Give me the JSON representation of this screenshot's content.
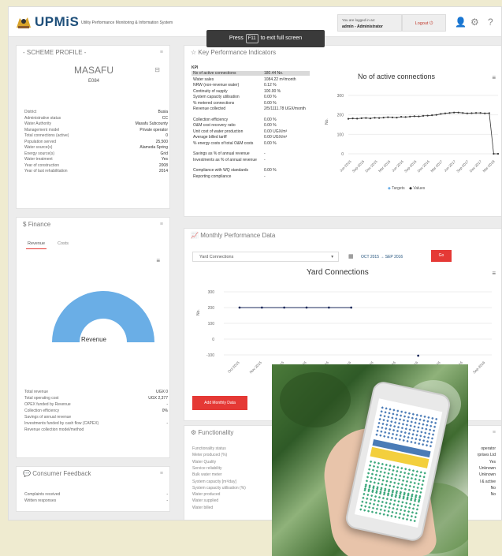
{
  "header": {
    "app_name": "UPMiS",
    "app_subtitle": "Utility Performance Monitoring & Information System",
    "logged_in_label": "You are logged in as:",
    "user": "admin - Administrator",
    "logout_label": "Logout",
    "fullscreen_press": "Press",
    "fullscreen_key": "F11",
    "fullscreen_text": "to exit full screen"
  },
  "scheme_profile": {
    "title": "- SCHEME PROFILE -",
    "name": "MASAFU",
    "code": "E084",
    "rows": [
      {
        "k": "District",
        "v": "Busia"
      },
      {
        "k": "Administrative status",
        "v": "CC"
      },
      {
        "k": "Water Authority",
        "v": "Masafu Subcounty"
      },
      {
        "k": "Management model",
        "v": "Private operator"
      },
      {
        "k": "Total connections (active)",
        "v": "0"
      },
      {
        "k": "Population served",
        "v": "25,500"
      },
      {
        "k": "Water source(s)",
        "v": "Alameda Spring"
      },
      {
        "k": "Energy source(s)",
        "v": "Grid"
      },
      {
        "k": "Water treatment",
        "v": "Yes"
      },
      {
        "k": "Year of construction",
        "v": "2008"
      },
      {
        "k": "Year of last rehabilitation",
        "v": "2014"
      }
    ]
  },
  "kpi": {
    "title": "Key Performance Indicators",
    "header": "KPI",
    "rows": [
      {
        "k": "No of active connections",
        "v": "180.44 No."
      },
      {
        "k": "Water sales",
        "v": "1084.22 m³/month"
      },
      {
        "k": "NRW (non-revenue water)",
        "v": "0.12 %"
      },
      {
        "k": "Continuity of supply",
        "v": "100.00 %"
      },
      {
        "k": "System capacity utilisation",
        "v": "0.00 %"
      },
      {
        "k": "% metered connections",
        "v": "0.00 %"
      },
      {
        "k": "Revenue collected",
        "v": "2/5/1111.78 UGX/month"
      },
      {
        "k": "Collection efficiency",
        "v": "0.00 %"
      },
      {
        "k": "O&M cost recovery ratio",
        "v": "0.00 %"
      },
      {
        "k": "Unit cost of water production",
        "v": "0.00 UGX/m³"
      },
      {
        "k": "Average billed tariff",
        "v": "0.00 UGX/m³"
      },
      {
        "k": "% energy costs of total O&M costs",
        "v": "0.00 %"
      },
      {
        "k": "Savings as % of annual revenue",
        "v": "-"
      },
      {
        "k": "Investments as % of annual revenue",
        "v": "-"
      },
      {
        "k": "Compliance with WQ standards",
        "v": "0.00 %"
      },
      {
        "k": "Reporting compliance",
        "v": "-"
      }
    ]
  },
  "conn_chart": {
    "title": "No of active connections",
    "ylabel": "No.",
    "yticks": [
      "300",
      "200",
      "100",
      "0"
    ],
    "xticks": [
      "Jun-2015",
      "Sep-2015",
      "Dec-2015",
      "Mar-2016",
      "Jun-2016",
      "Sep-2016",
      "Dec-2016",
      "Mar-2017",
      "Jun-2017",
      "Sep-2017",
      "Dec-2017",
      "Mar-2018"
    ],
    "legend_targets": "Targets",
    "legend_values": "Values"
  },
  "chart_data": [
    {
      "type": "line",
      "title": "No of active connections",
      "ylabel": "No.",
      "ylim": [
        0,
        300
      ],
      "series": [
        {
          "name": "Values",
          "values": [
            180,
            182,
            181,
            183,
            184,
            182,
            185,
            184,
            186,
            188,
            187,
            186,
            190,
            189,
            191,
            193,
            192,
            195,
            196,
            198,
            200,
            205,
            208,
            210,
            212,
            212,
            210,
            208,
            209,
            210,
            210,
            208,
            209,
            0,
            0
          ]
        }
      ]
    },
    {
      "type": "line",
      "title": "Yard Connections",
      "ylabel": "No.",
      "ylim": [
        0,
        300
      ],
      "categories": [
        "Oct-2015",
        "Nov-2015",
        "Dec-2015",
        "Jan-2016",
        "Feb-2016",
        "Mar-2016",
        "Apr-2016",
        "May-2016",
        "Jun-2016",
        "Jul-2016",
        "Aug-2016",
        "Sep-2016"
      ],
      "series": [
        {
          "name": "Values",
          "values": [
            200,
            200,
            200,
            200,
            200,
            200
          ]
        }
      ]
    }
  ],
  "finance": {
    "title": "Finance",
    "tab_revenue": "Revenue",
    "tab_costs": "Costs",
    "donut_label": "Revenue",
    "rows": [
      {
        "k": "Total revenue",
        "v": "UGX 0"
      },
      {
        "k": "Total operating cost",
        "v": "UGX 2,377"
      },
      {
        "k": "OPEX funded by Revenue",
        "v": "-"
      },
      {
        "k": "Collection efficiency",
        "v": "0%"
      },
      {
        "k": "Savings of annual revenue",
        "v": ""
      },
      {
        "k": "Investments funded by cash flow (CAPEX)",
        "v": "-"
      },
      {
        "k": "Revenue collection model/method",
        "v": ""
      }
    ]
  },
  "monthly": {
    "title": "Monthly Performance Data",
    "select": "Yard Connections",
    "date_from": "OCT 2015",
    "date_to": "SEP 2016",
    "go": "Go",
    "chart_title": "Yard Connections",
    "ylabel": "No.",
    "yticks": [
      "300",
      "200",
      "100",
      "0",
      "-100"
    ],
    "xticks": [
      "Oct-2015",
      "Nov-2015",
      "Dec-2015",
      "Jan-2016",
      "Feb-2016",
      "Mar-2016",
      "Apr-2016",
      "May-2016",
      "Jun-2016",
      "Jul-2016",
      "Aug-2016",
      "Sep-2016"
    ],
    "add_button": "Add Monthly Data"
  },
  "functionality": {
    "title": "Functionality",
    "rows": [
      "Functionality status",
      "Meter produced (%)",
      "Water Quality",
      "Service reliability",
      "Bulk water meter",
      "System capacity [m³/day]",
      "System capacity utilisation (%)",
      "Water produced",
      "Water supplied",
      "Water billed"
    ],
    "right_values": [
      "operator",
      "rprises Ltd",
      "Yes",
      "Unknown",
      "Unknown",
      "l & active",
      "No",
      "No"
    ]
  },
  "feedback": {
    "title": "Consumer Feedback",
    "rows": [
      {
        "k": "Complaints received",
        "v": "-"
      },
      {
        "k": "Written responses",
        "v": "-"
      }
    ]
  },
  "colors": {
    "accent": "#1e4f7a",
    "red": "#e53935",
    "donut": "#6aaee6"
  }
}
